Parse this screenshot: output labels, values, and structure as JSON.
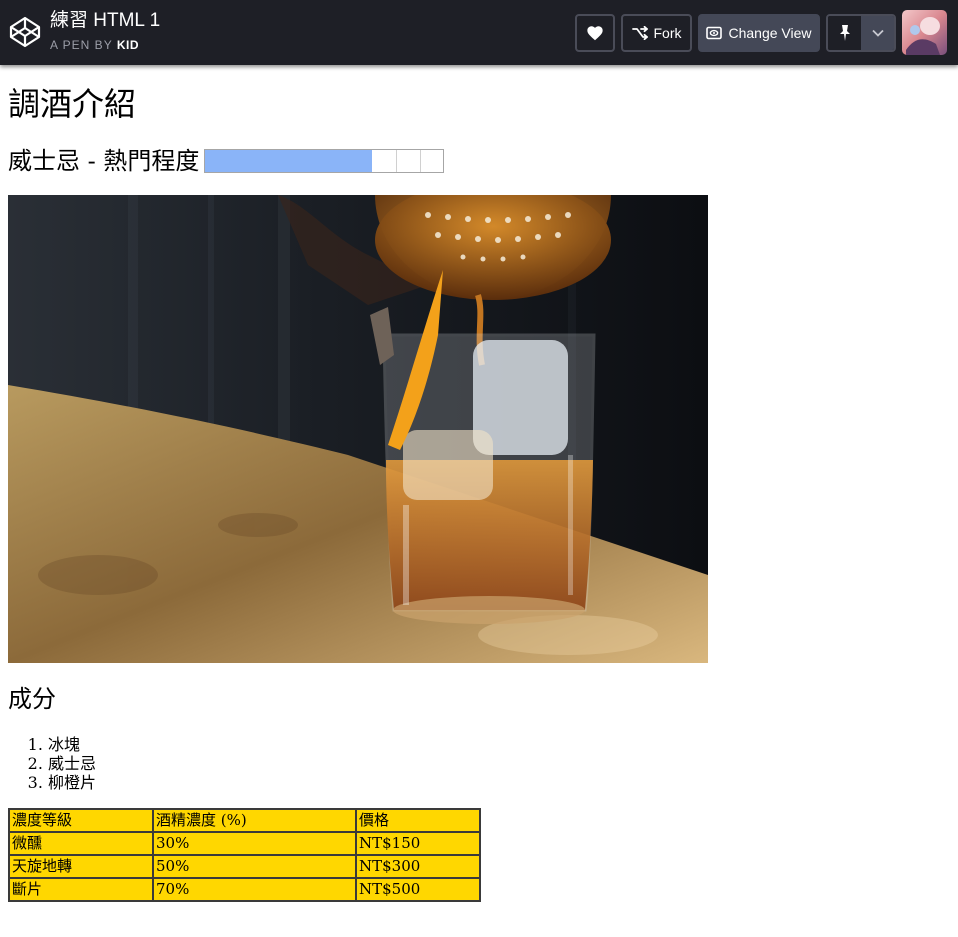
{
  "header": {
    "title": "練習 HTML 1",
    "byline_prefix": "A PEN BY",
    "author": "KID",
    "buttons": {
      "heart_icon": "heart-icon",
      "fork_label": "Fork",
      "change_view_label": "Change View"
    },
    "colors": {
      "bar_bg": "#1e1f26",
      "button_bg": "#444857"
    }
  },
  "page": {
    "title": "調酒介紹",
    "popularity": {
      "label": "威士忌 - 熱門程度",
      "meter_value": 0.7,
      "fill_color": "#8ab4f8"
    },
    "ingredients_heading": "成分",
    "ingredients": [
      "冰塊",
      "威士忌",
      "柳橙片"
    ],
    "table": {
      "headers": [
        "濃度等級",
        "酒精濃度 (%)",
        "價格"
      ],
      "rows": [
        [
          "微醺",
          "30%",
          "NT$150"
        ],
        [
          "天旋地轉",
          "50%",
          "NT$300"
        ],
        [
          "斷片",
          "70%",
          "NT$500"
        ]
      ],
      "background": "#ffd700"
    }
  }
}
